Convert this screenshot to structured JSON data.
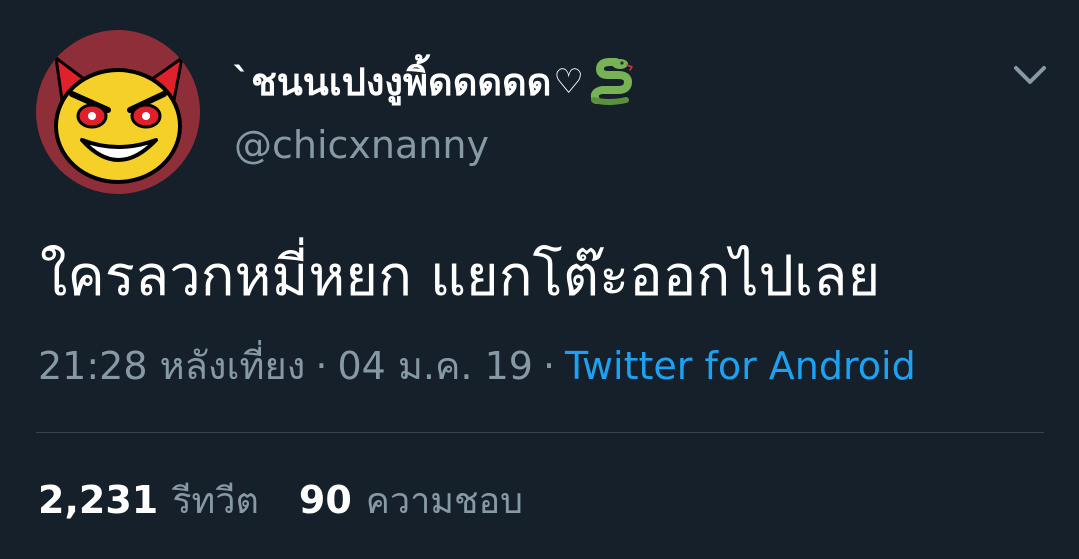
{
  "tweet": {
    "author": {
      "display_name": "`ชนนเปงงูพิ้ดดดดด",
      "name_symbol": "♡",
      "name_emoji_icon": "snake-icon",
      "username": "@chicxnanny",
      "avatar_icon": "devil-smiley-icon"
    },
    "more_icon": "chevron-down-icon",
    "text": "ใครลวกหมี่หยก แยกโต๊ะออกไปเลย",
    "time": "21:28 หลังเที่ยง",
    "separator": "·",
    "date": "04 ม.ค. 19",
    "source": "Twitter for Android",
    "stats": {
      "retweets_count": "2,231",
      "retweets_label": "รีทวีต",
      "likes_count": "90",
      "likes_label": "ความชอบ"
    }
  },
  "colors": {
    "background": "#15202b",
    "primary_text": "#ffffff",
    "secondary_text": "#8899a6",
    "link": "#1da1f2",
    "divider": "#38444d",
    "avatar_bg": "#8e2e39"
  }
}
